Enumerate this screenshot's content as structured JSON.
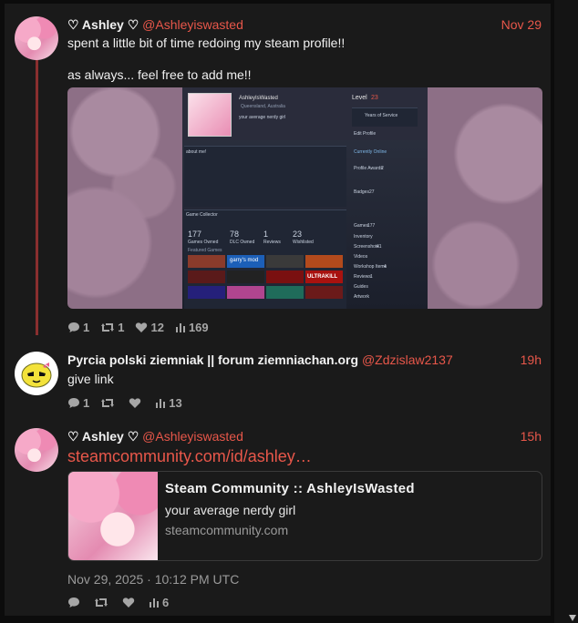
{
  "colors": {
    "accent": "#e8574a",
    "thread_line": "#8a2f2f",
    "panel": "#1a1a1a",
    "muted": "#9a9a9a"
  },
  "posts": [
    {
      "display_name": "♡ Ashley ♡",
      "handle": "@Ashleyiswasted",
      "time": "Nov 29",
      "text_lines": [
        "spent a little bit of time redoing my steam profile!!",
        "as always... feel free to add me!!"
      ],
      "actions": {
        "replies": "1",
        "reposts": "1",
        "likes": "12",
        "views": "169"
      },
      "media": {
        "profile_name": "AshleyIsWasted",
        "location": "Queensland, Australia",
        "bio": "your average nerdy girl",
        "level_label": "Level",
        "level": "23",
        "badge_text": "Years of Service",
        "edit_profile": "Edit Profile",
        "about_me": "about me!",
        "game_collector": "Game Collector",
        "stats": [
          {
            "value": "177",
            "label": "Games Owned"
          },
          {
            "value": "78",
            "label": "DLC Owned"
          },
          {
            "value": "1",
            "label": "Reviews"
          },
          {
            "value": "23",
            "label": "Wishlisted"
          }
        ],
        "featured_games": "Featured Games",
        "tiles": [
          "garry's mod",
          "ULTRAKILL"
        ],
        "currently_online": "Currently Online",
        "side_items": [
          "Profile Awards",
          "Badges",
          "Games",
          "Inventory",
          "Screenshots",
          "Videos",
          "Workshop Items",
          "Reviews",
          "Guides",
          "Artwork"
        ],
        "side_counts": [
          "2",
          "27",
          "177",
          "41",
          "4",
          "1"
        ]
      }
    },
    {
      "display_name": "Pyrcia polski ziemniak || forum ziemniachan.org",
      "handle": "@Zdzislaw2137",
      "time": "19h",
      "text": "give link",
      "actions": {
        "replies": "1",
        "reposts": "",
        "likes": "",
        "views": "13"
      }
    },
    {
      "display_name": "♡ Ashley ♡",
      "handle": "@Ashleyiswasted",
      "time": "15h",
      "link_text": "steamcommunity.com/id/ashley…",
      "card": {
        "title": "Steam Community :: AshleyIsWasted",
        "description": "your average nerdy girl",
        "domain": "steamcommunity.com"
      },
      "timestamp": "Nov 29, 2025 · 10:12 PM UTC",
      "actions": {
        "replies": "",
        "reposts": "",
        "likes": "",
        "views": "6"
      }
    }
  ]
}
